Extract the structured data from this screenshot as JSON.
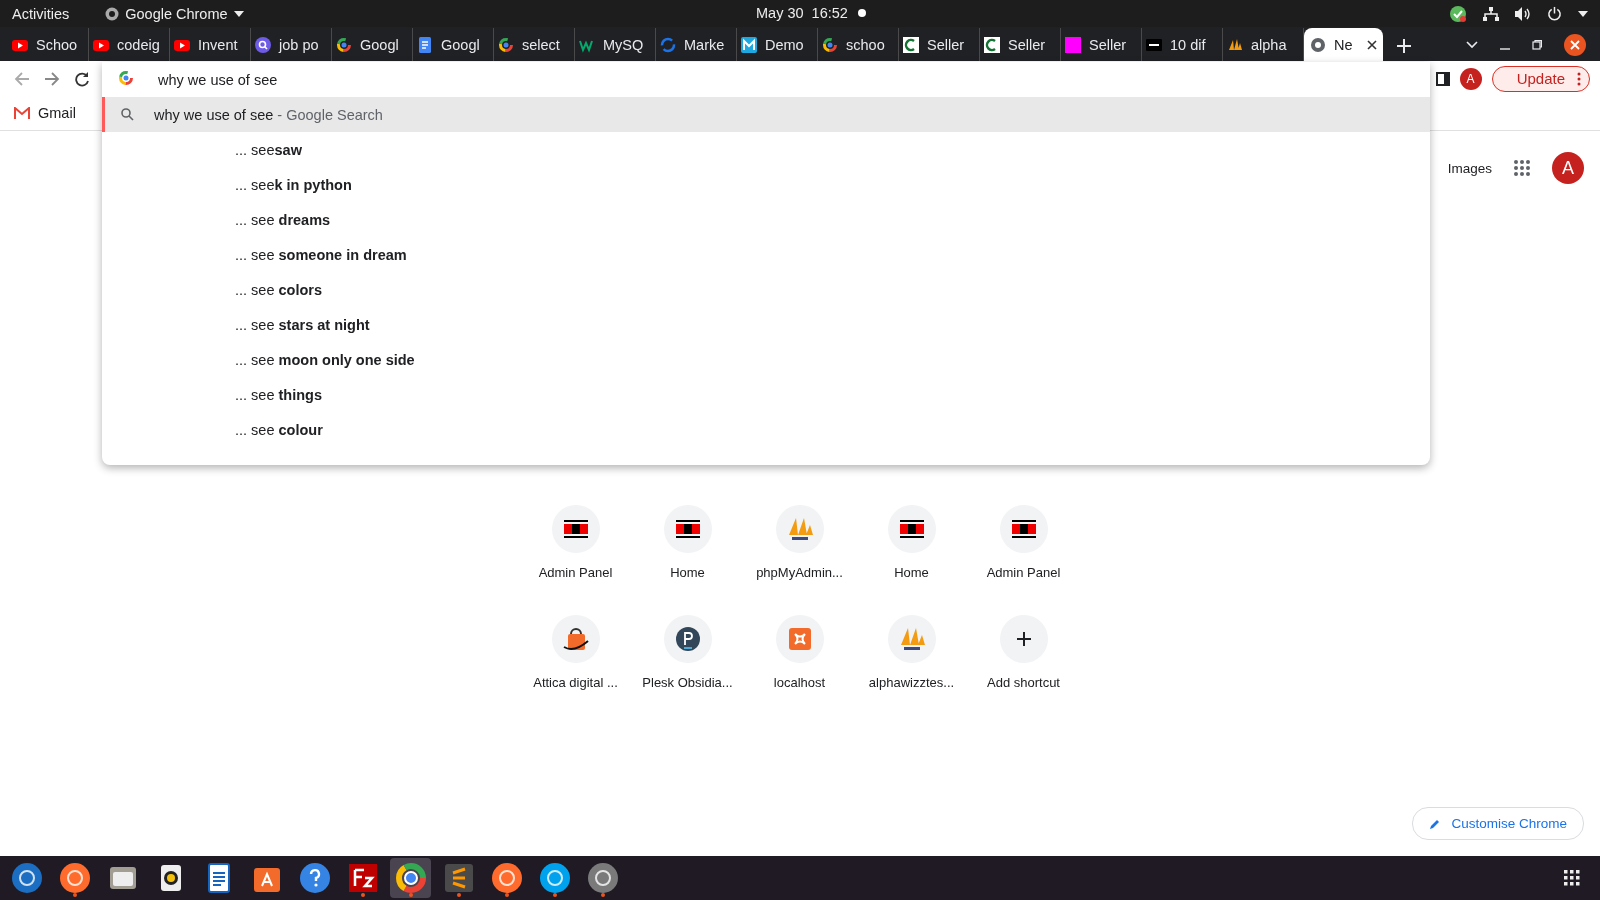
{
  "system_bar": {
    "activities": "Activities",
    "app": "Google Chrome",
    "clock": "May 30  16:52"
  },
  "tabs": [
    {
      "kind": "play",
      "label": "Schoo",
      "selected": false
    },
    {
      "kind": "play",
      "label": "codeig",
      "selected": false
    },
    {
      "kind": "play",
      "label": "Invent",
      "selected": false
    },
    {
      "kind": "magnifier",
      "label": "job po",
      "selected": false
    },
    {
      "kind": "ring",
      "label": "Googl",
      "selected": false
    },
    {
      "kind": "document",
      "label": "Googl",
      "selected": false
    },
    {
      "kind": "ring",
      "label": "select",
      "selected": false
    },
    {
      "kind": "zigzag",
      "label": "MySQ",
      "selected": false
    },
    {
      "kind": "swirl",
      "label": "Marke",
      "selected": false
    },
    {
      "kind": "cyan",
      "label": "Demo",
      "selected": false
    },
    {
      "kind": "ring",
      "label": "schoo",
      "selected": false
    },
    {
      "kind": "arc",
      "label": "Seller",
      "selected": false
    },
    {
      "kind": "arc",
      "label": "Seller",
      "selected": false
    },
    {
      "kind": "magenta",
      "label": "Seller",
      "selected": false
    },
    {
      "kind": "black",
      "label": "10 dif",
      "selected": false
    },
    {
      "kind": "sail",
      "label": "alpha",
      "selected": false
    },
    {
      "kind": "circle",
      "label": "Ne",
      "selected": true
    }
  ],
  "toolbar": {
    "profile_initial": "A",
    "update_button": "Update"
  },
  "bookmarks": [
    {
      "label": "Gmail"
    }
  ],
  "omnibox": {
    "value": "why we use of see",
    "suggestions": [
      {
        "kind": "search",
        "text": "why we use of see",
        "hint": "- Google Search",
        "selected": true
      },
      {
        "kind": "completion",
        "text": "... see**saw**",
        "selected": false
      },
      {
        "kind": "completion",
        "text": "... see**k in python**",
        "selected": false
      },
      {
        "kind": "completion",
        "text": "... see **dreams**",
        "selected": false
      },
      {
        "kind": "completion",
        "text": "... see **someone in dream**",
        "selected": false
      },
      {
        "kind": "completion",
        "text": "... see **colors**",
        "selected": false
      },
      {
        "kind": "completion",
        "text": "... see **stars at night**",
        "selected": false
      },
      {
        "kind": "completion",
        "text": "... see **moon only one side**",
        "selected": false
      },
      {
        "kind": "completion",
        "text": "... see **things**",
        "selected": false
      },
      {
        "kind": "completion",
        "text": "... see **colour**",
        "selected": false
      }
    ]
  },
  "new_tab_page": {
    "images_link": "Images",
    "avatar": "A",
    "customise_button": "Customise Chrome",
    "shortcuts": [
      {
        "kind": "b2k",
        "label": "Admin Panel"
      },
      {
        "kind": "b2k",
        "label": "Home"
      },
      {
        "kind": "sail",
        "label": "phpMyAdmin..."
      },
      {
        "kind": "b2k",
        "label": "Home"
      },
      {
        "kind": "b2k",
        "label": "Admin Panel"
      },
      {
        "kind": "bag",
        "label": "Attica digital ..."
      },
      {
        "kind": "disc",
        "label": "Plesk Obsidia..."
      },
      {
        "kind": "tile",
        "label": "localhost"
      },
      {
        "kind": "sail",
        "label": "alphawizztes..."
      },
      {
        "kind": "add",
        "label": "Add shortcut"
      }
    ]
  },
  "dock": [
    {
      "kind": "bluecircle",
      "running": false,
      "selected": false
    },
    {
      "kind": "orangecircle",
      "running": true,
      "selected": false
    },
    {
      "kind": "folder",
      "running": false,
      "selected": false
    },
    {
      "kind": "speaker",
      "running": false,
      "selected": false
    },
    {
      "kind": "document",
      "running": false,
      "selected": false
    },
    {
      "kind": "bag",
      "running": false,
      "selected": false
    },
    {
      "kind": "help",
      "running": false,
      "selected": false
    },
    {
      "kind": "redsquare",
      "running": true,
      "selected": false
    },
    {
      "kind": "ring",
      "running": true,
      "selected": true
    },
    {
      "kind": "darksquare",
      "running": true,
      "selected": false
    },
    {
      "kind": "orangecircle",
      "running": true,
      "selected": false
    },
    {
      "kind": "skycircle",
      "running": true,
      "selected": false
    },
    {
      "kind": "greycircle",
      "running": true,
      "selected": false
    }
  ]
}
